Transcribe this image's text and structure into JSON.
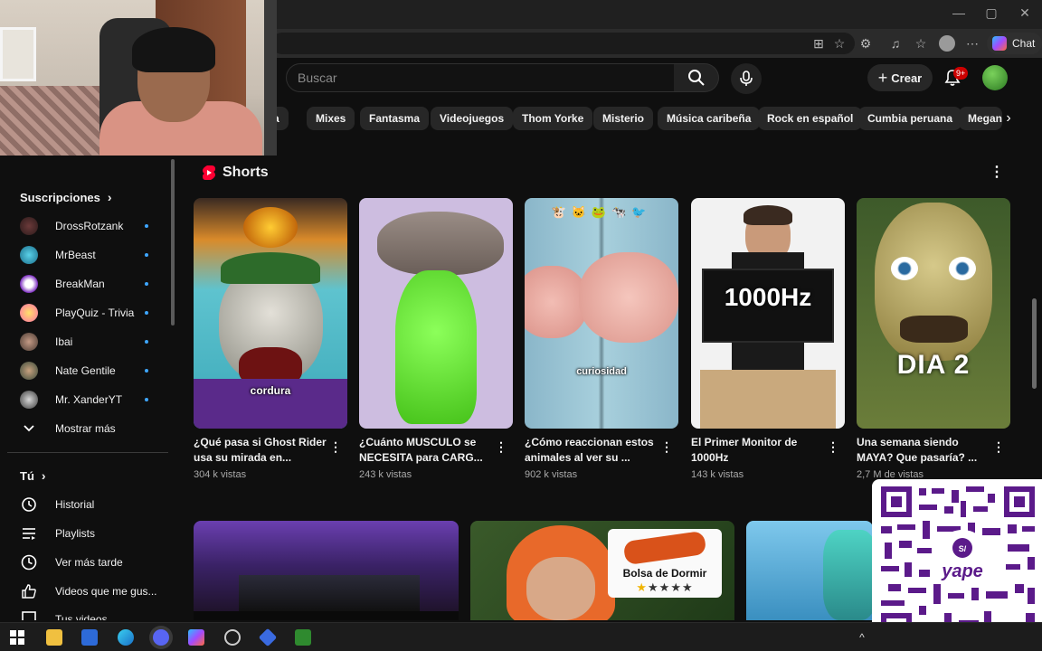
{
  "header": {
    "search_placeholder": "Buscar",
    "create_label": "Crear",
    "notifications_badge": "9+"
  },
  "browser": {
    "chat_label": "Chat",
    "minimize": "—",
    "maximize": "▢",
    "close": "✕"
  },
  "chips": [
    "ica",
    "Mixes",
    "Fantasma",
    "Videojuegos",
    "Thom Yorke",
    "Misterio",
    "Música caribeña",
    "Rock en español",
    "Cumbia peruana",
    "Megan"
  ],
  "sidebar": {
    "subscriptions_title": "Suscripciones",
    "subscriptions": [
      {
        "name": "DrossRotzank"
      },
      {
        "name": "MrBeast"
      },
      {
        "name": "BreakMan"
      },
      {
        "name": "PlayQuiz - Trivia"
      },
      {
        "name": "Ibai"
      },
      {
        "name": "Nate Gentile"
      },
      {
        "name": "Mr. XanderYT"
      }
    ],
    "show_more": "Mostrar más",
    "you_title": "Tú",
    "you_items": [
      {
        "label": "Historial",
        "icon": "history-icon"
      },
      {
        "label": "Playlists",
        "icon": "playlists-icon"
      },
      {
        "label": "Ver más tarde",
        "icon": "watch-later-icon"
      },
      {
        "label": "Videos que me gus...",
        "icon": "liked-icon"
      },
      {
        "label": "Tus videos",
        "icon": "your-videos-icon"
      }
    ]
  },
  "shorts": {
    "title": "Shorts",
    "items": [
      {
        "title": "¿Qué pasa si Ghost Rider usa su mirada en...",
        "views": "304 k vistas",
        "caption": "cordura"
      },
      {
        "title": "¿Cuánto MUSCULO se NECESITA para CARG...",
        "views": "243 k vistas",
        "caption": ""
      },
      {
        "title": "¿Cómo reaccionan estos animales al ver su ...",
        "views": "902 k vistas",
        "caption": "curiosidad"
      },
      {
        "title": "El Primer Monitor de 1000Hz",
        "views": "143 k vistas",
        "caption": "1000Hz"
      },
      {
        "title": "Una semana siendo MAYA? Que pasaría? ...",
        "views": "2,7 M de vistas",
        "caption": "DIA 2"
      }
    ]
  },
  "videos": {
    "bolsa_text": "Bolsa de Dormir",
    "bolsa_stars": "★★★★★"
  },
  "colors": {
    "accent_red": "#ff0033",
    "dot_blue": "#3ea6ff",
    "qr_purple": "#5b1a8a"
  }
}
